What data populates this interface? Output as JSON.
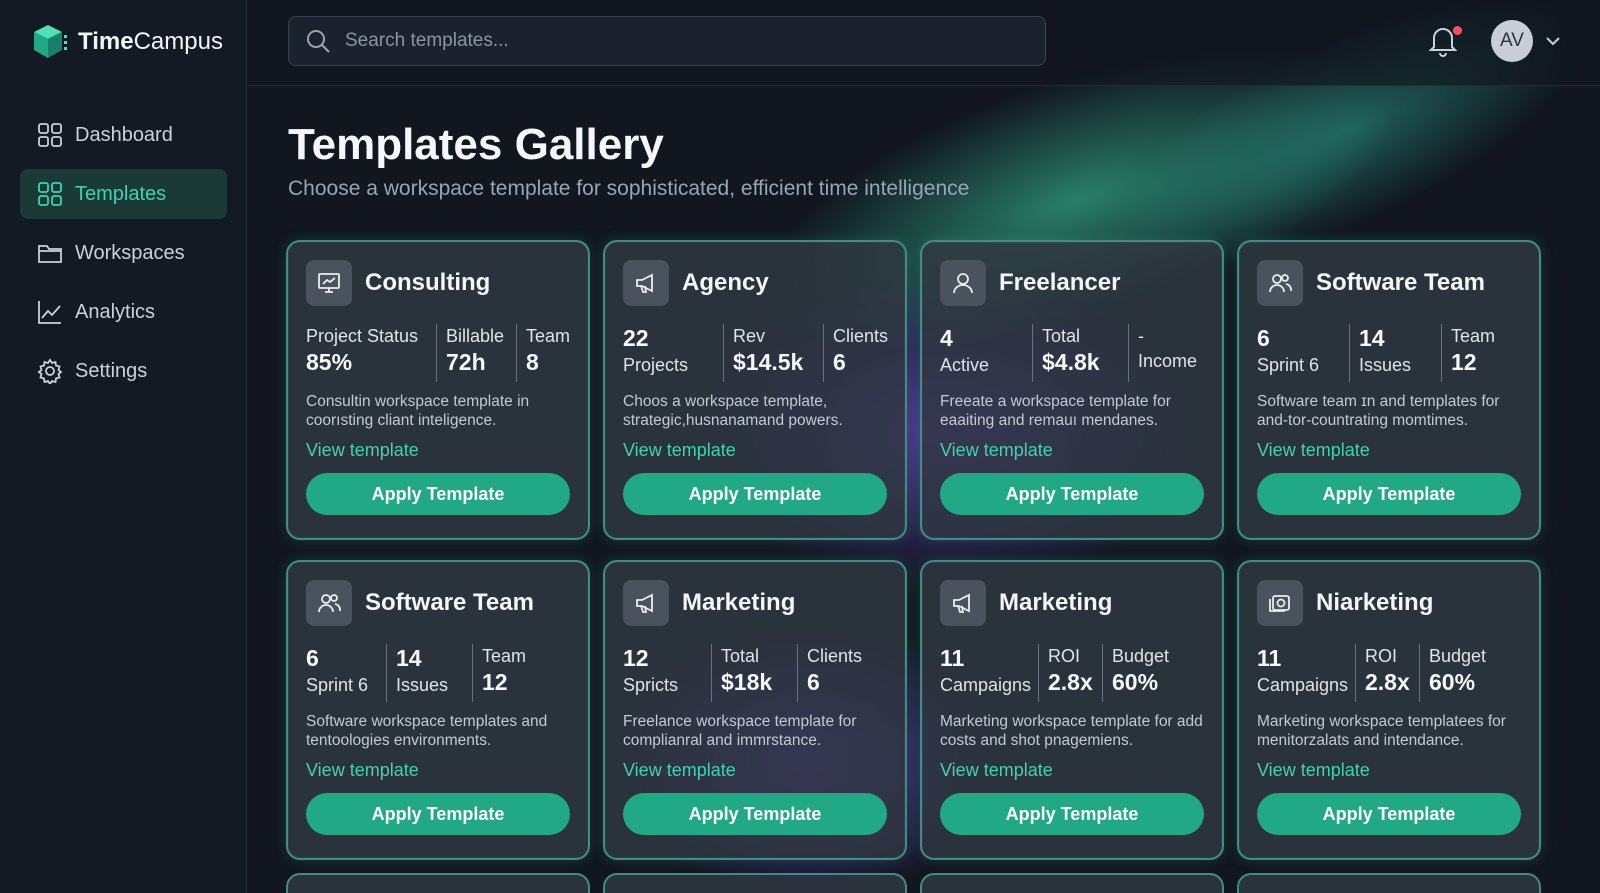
{
  "app": {
    "name_bold": "Time",
    "name_rest": "Campus"
  },
  "sidebar": {
    "items": [
      {
        "label": "Dashboard",
        "icon": "grid-icon"
      },
      {
        "label": "Templates",
        "icon": "grid-icon"
      },
      {
        "label": "Workspaces",
        "icon": "folder-icon"
      },
      {
        "label": "Analytics",
        "icon": "chart-icon"
      },
      {
        "label": "Settings",
        "icon": "gear-icon"
      }
    ]
  },
  "search": {
    "placeholder": "Search templates..."
  },
  "user": {
    "initials": "AV"
  },
  "page": {
    "title": "Templates Gallery",
    "subtitle": "Choose a workspace template for sophisticated, efficient time intelligence"
  },
  "colors": {
    "accent": "#3dd4b0",
    "button": "#21a884",
    "notification": "#ff4d5e"
  },
  "cards": [
    {
      "title": "Consulting",
      "icon": "presentation-icon",
      "s1": {
        "a": "Project Status",
        "b": "85%"
      },
      "s2": {
        "a": "Billable",
        "b": "72h"
      },
      "s3": {
        "a": "Team",
        "b": "8"
      },
      "desc": "Consultin workspace template in coorısting cliant inteligence.",
      "link": "View template",
      "button": "Apply Template"
    },
    {
      "title": "Agency",
      "icon": "megaphone-icon",
      "s1": {
        "a": "22",
        "b": "Projects"
      },
      "s2": {
        "a": "Rev",
        "b": "$14.5k"
      },
      "s3": {
        "a": "Clients",
        "b": "6"
      },
      "desc": "Choos a workspace template, strategic,husnanamand powers.",
      "link": "View template",
      "button": "Apply Template"
    },
    {
      "title": "Freelancer",
      "icon": "user-icon",
      "s1": {
        "a": "4",
        "b": "Active"
      },
      "s2": {
        "a": "Total",
        "b": "$4.8k"
      },
      "s3": {
        "a": "-",
        "b": "Income"
      },
      "desc": "Freeate a workspace template for eaaiting and remauı mendanes.",
      "link": "View template",
      "button": "Apply Template"
    },
    {
      "title": "Software Team",
      "icon": "users-icon",
      "s1": {
        "a": "6",
        "b": "Sprint 6"
      },
      "s2": {
        "a": "14",
        "b": "Issues"
      },
      "s3": {
        "a": "Team",
        "b": "12"
      },
      "desc": "Software team ɪn and templates for and-tor-countrating momtimes.",
      "link": "View template",
      "button": "Apply Template"
    },
    {
      "title": "Software Team",
      "icon": "users-icon",
      "s1": {
        "a": "6",
        "b": "Sprint 6"
      },
      "s2": {
        "a": "14",
        "b": "Issues"
      },
      "s3": {
        "a": "Team",
        "b": "12"
      },
      "desc": "Software workspace templates and tentoologies environments.",
      "link": "View template",
      "button": "Apply Template"
    },
    {
      "title": "Marketing",
      "icon": "megaphone-icon",
      "s1": {
        "a": "12",
        "b": "Spricts"
      },
      "s2": {
        "a": "Total",
        "b": "$18k"
      },
      "s3": {
        "a": "Clients",
        "b": "6"
      },
      "desc": "Freelance workspace template for complianral and immrstance.",
      "link": "View template",
      "button": "Apply Template"
    },
    {
      "title": "Marketing",
      "icon": "megaphone-icon",
      "s1": {
        "a": "11",
        "b": "Campaigns"
      },
      "s2": {
        "a": "ROI",
        "b": "2.8x"
      },
      "s3": {
        "a": "Budget",
        "b": "60%"
      },
      "desc": "Marketing workspace template for add costs and shot pnagemiens.",
      "link": "View template",
      "button": "Apply Template"
    },
    {
      "title": "Niarketing",
      "icon": "camera-icon",
      "s1": {
        "a": "11",
        "b": "Campaigns"
      },
      "s2": {
        "a": "ROI",
        "b": "2.8x"
      },
      "s3": {
        "a": "Budget",
        "b": "60%"
      },
      "desc": "Marketing workspace templatees for menitorzalats and intendance.",
      "link": "View template",
      "button": "Apply Template"
    }
  ]
}
